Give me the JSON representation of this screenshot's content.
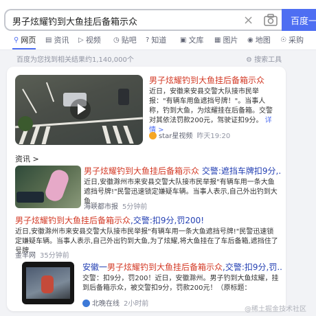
{
  "search": {
    "query": "男子炫耀钓到大鱼挂后备箱示众",
    "button_label": "百度一",
    "clear_glyph": "×"
  },
  "tabs": [
    {
      "label": "网页",
      "icon": "search-icon"
    },
    {
      "label": "资讯",
      "icon": "news-icon"
    },
    {
      "label": "视频",
      "icon": "video-icon"
    },
    {
      "label": "贴吧",
      "icon": "tieba-icon"
    },
    {
      "label": "知道",
      "icon": "question-icon"
    },
    {
      "label": "文库",
      "icon": "doc-icon"
    },
    {
      "label": "图片",
      "icon": "image-icon"
    },
    {
      "label": "地图",
      "icon": "map-icon"
    },
    {
      "label": "采购",
      "icon": "cart-icon"
    }
  ],
  "result_count": "百度为您找到相关结果约1,140,000个",
  "search_tools": "搜索工具",
  "video_result": {
    "title": "男子炫耀钓到大鱼挂后备箱示众",
    "desc": "近日，安徽来安县交警大队接市民举报：\"有辆车用鱼遮挡号牌！\"。当事人称，钓到大鱼，为炫耀挂在后备箱。交警对其依法罚款200元，驾驶证扣9分。",
    "detail_link": "详情 >",
    "source": "star星视频",
    "time": "昨天19:20"
  },
  "section_label": "资讯 >",
  "news": [
    {
      "title_red": "男子炫耀钓到大鱼挂后备箱示众",
      "title_blue": " 交警:遮挡车牌扣9分,...",
      "desc": "近日,安徽滁州市来安县交警大队接市民举报\"有辆车用一条大鱼遮挡号牌!\"民警迅速锁定嫌疑车辆。当事人表示,自己外出钓到大鱼...",
      "source": "海峡都市报",
      "time": "5分钟前"
    },
    {
      "title_red": "男子炫耀钓到大鱼挂后备箱示众",
      "title_blue": ",交警:扣9分,罚200!",
      "desc": "近日,安徽滁州市来安县交警大队接市民举报\"有辆车用一条大鱼遮挡号牌!\"民警迅速锁定嫌疑车辆。当事人表示,自己外出钓到大鱼,为了炫耀,将大鱼挂在了车后备箱,遮挡住了号牌...",
      "source": "金羊网",
      "time": "35分钟前"
    },
    {
      "title_prefix": "安徽一",
      "title_red": "男子炫耀钓到大鱼挂后备箱示众",
      "title_blue": ",交警:扣9分,罚...",
      "desc": "交警：扣9分，罚200！近日，安徽滁州。男子钓到大鱼炫耀，挂到后备箱示众，被交警扣9分，罚款200元！（原标题：",
      "source": "北晚在线",
      "time": "2小时前"
    }
  ],
  "watermark": "@稀土掘金技术社区",
  "colors": {
    "accent": "#4e6ef2",
    "title_red": "#d33a26",
    "title_blue": "#2440b3"
  }
}
